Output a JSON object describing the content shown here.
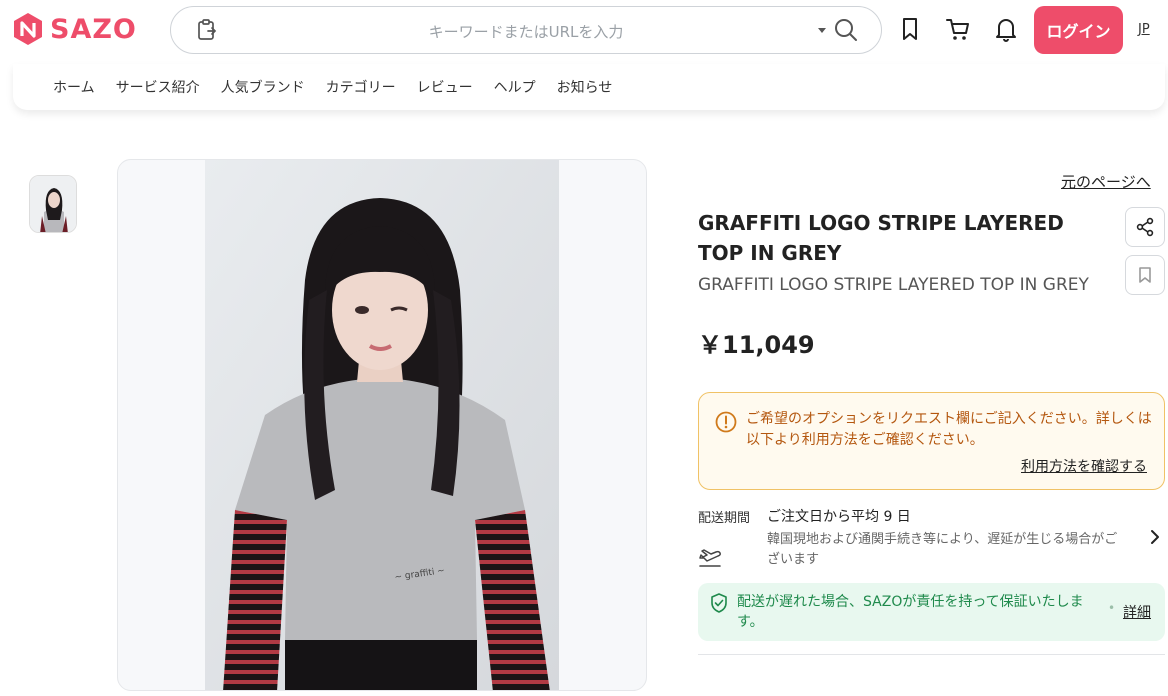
{
  "header": {
    "logo_text": "SAZO",
    "search_placeholder": "キーワードまたはURLを入力",
    "login_label": "ログイン",
    "language": "JP",
    "brand_color": "#ee4d6a"
  },
  "nav": {
    "items": [
      "ホーム",
      "サービス紹介",
      "人気ブランド",
      "カテゴリー",
      "レビュー",
      "ヘルプ",
      "お知らせ"
    ]
  },
  "product": {
    "back_link": "元のページへ",
    "title": "GRAFFITI LOGO STRIPE LAYERED TOP IN GREY",
    "subtitle": "GRAFFITI LOGO STRIPE LAYERED TOP IN GREY",
    "price": "￥11,049"
  },
  "notice": {
    "text": "ご希望のオプションをリクエスト欄にご記入ください。詳しくは以下より利用方法をご確認ください。",
    "link": "利用方法を確認する",
    "color": "#b4570f"
  },
  "shipping": {
    "label": "配送期間",
    "value": "ご注文日から平均 9 日",
    "note": "韓国現地および通関手続き等により、遅延が生じる場合がございます"
  },
  "guarantee": {
    "text": "配送が遅れた場合、SAZOが責任を持って保証いたします。",
    "link": "詳細",
    "color": "#1f8a4c"
  },
  "icons": {
    "clip": "clipboard-icon",
    "search": "search-icon",
    "bookmark": "bookmark-icon",
    "cart": "cart-icon",
    "bell": "bell-icon",
    "share": "share-icon",
    "warning": "warning-icon",
    "plane": "plane-icon",
    "shield": "shield-icon"
  }
}
